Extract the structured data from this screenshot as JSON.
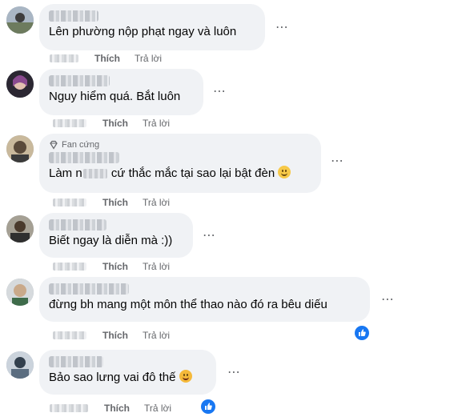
{
  "actions": {
    "like_label": "Thích",
    "reply_label": "Trả lời",
    "more_icon": "⋯"
  },
  "comments": [
    {
      "text": "Lên phường nộp phạt ngay và luôn"
    },
    {
      "text": "Nguy hiểm quá. Bắt luôn"
    },
    {
      "badge": "Fan cứng",
      "text_before": "Làm n",
      "text_after": " cứ thắc mắc tại sao lại bật đèn"
    },
    {
      "text": "Biết ngay là diễn mà :))"
    },
    {
      "text": "đừng bh mang một môn thể thao nào đó ra bêu diếu",
      "reaction": "like-reaction-icon"
    },
    {
      "text": "Bảo sao lưng vai đô thế",
      "reaction": "like-reaction-icon"
    }
  ],
  "colors": {
    "bubble": "#f0f2f5",
    "like_blue": "#1877f2",
    "secondary_text": "#65676b"
  }
}
